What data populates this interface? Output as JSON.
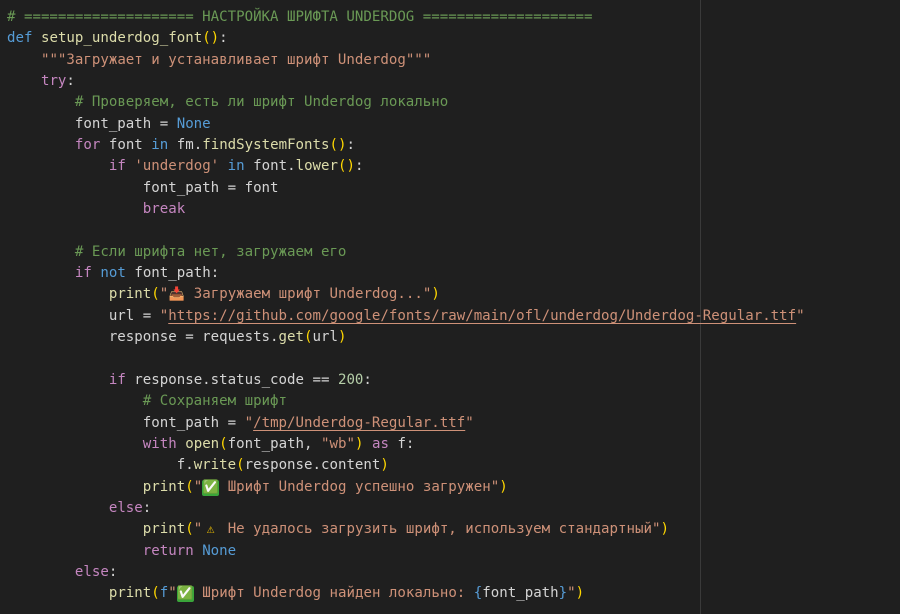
{
  "editor": {
    "language": "python",
    "lines": [
      [
        [
          "cm",
          "# ==================== НАСТРОЙКА ШРИФТА UNDERDOG ===================="
        ]
      ],
      [
        [
          "kw",
          "def"
        ],
        [
          "txt",
          " "
        ],
        [
          "fn",
          "setup_underdog_font"
        ],
        [
          "br1",
          "()"
        ],
        [
          "txt",
          ":"
        ]
      ],
      [
        [
          "txt",
          "    "
        ],
        [
          "str",
          "\"\"\"Загружает и устанавливает шрифт Underdog\"\"\""
        ]
      ],
      [
        [
          "txt",
          "    "
        ],
        [
          "ctl",
          "try"
        ],
        [
          "txt",
          ":"
        ]
      ],
      [
        [
          "txt",
          "        "
        ],
        [
          "cm",
          "# Проверяем, есть ли шрифт Underdog локально"
        ]
      ],
      [
        [
          "txt",
          "        font_path = "
        ],
        [
          "kw",
          "None"
        ]
      ],
      [
        [
          "txt",
          "        "
        ],
        [
          "ctl",
          "for"
        ],
        [
          "txt",
          " font "
        ],
        [
          "kw",
          "in"
        ],
        [
          "txt",
          " fm."
        ],
        [
          "fn",
          "findSystemFonts"
        ],
        [
          "br1",
          "()"
        ],
        [
          "txt",
          ":"
        ]
      ],
      [
        [
          "txt",
          "            "
        ],
        [
          "ctl",
          "if"
        ],
        [
          "txt",
          " "
        ],
        [
          "str",
          "'underdog'"
        ],
        [
          "txt",
          " "
        ],
        [
          "kw",
          "in"
        ],
        [
          "txt",
          " font."
        ],
        [
          "fn",
          "lower"
        ],
        [
          "br1",
          "()"
        ],
        [
          "txt",
          ":"
        ]
      ],
      [
        [
          "txt",
          "                font_path = font"
        ]
      ],
      [
        [
          "txt",
          "                "
        ],
        [
          "ctl",
          "break"
        ]
      ],
      [],
      [
        [
          "txt",
          "        "
        ],
        [
          "cm",
          "# Если шрифта нет, загружаем его"
        ]
      ],
      [
        [
          "txt",
          "        "
        ],
        [
          "ctl",
          "if"
        ],
        [
          "txt",
          " "
        ],
        [
          "kw",
          "not"
        ],
        [
          "txt",
          " font_path:"
        ]
      ],
      [
        [
          "txt",
          "            "
        ],
        [
          "fn",
          "print"
        ],
        [
          "br1",
          "("
        ],
        [
          "str",
          "\""
        ],
        [
          "emoji",
          "📥"
        ],
        [
          "str",
          " Загружаем шрифт Underdog...\""
        ],
        [
          "br1",
          ")"
        ]
      ],
      [
        [
          "txt",
          "            url = "
        ],
        [
          "str",
          "\""
        ],
        [
          "lnk",
          "https://github.com/google/fonts/raw/main/ofl/underdog/Underdog-Regular.ttf"
        ],
        [
          "str",
          "\""
        ]
      ],
      [
        [
          "txt",
          "            response = requests."
        ],
        [
          "fn",
          "get"
        ],
        [
          "br1",
          "("
        ],
        [
          "txt",
          "url"
        ],
        [
          "br1",
          ")"
        ]
      ],
      [],
      [
        [
          "txt",
          "            "
        ],
        [
          "ctl",
          "if"
        ],
        [
          "txt",
          " response.status_code == "
        ],
        [
          "num",
          "200"
        ],
        [
          "txt",
          ":"
        ]
      ],
      [
        [
          "txt",
          "                "
        ],
        [
          "cm",
          "# Сохраняем шрифт"
        ]
      ],
      [
        [
          "txt",
          "                font_path = "
        ],
        [
          "str",
          "\""
        ],
        [
          "lnk",
          "/tmp/Underdog-Regular.ttf"
        ],
        [
          "str",
          "\""
        ]
      ],
      [
        [
          "txt",
          "                "
        ],
        [
          "ctl",
          "with"
        ],
        [
          "txt",
          " "
        ],
        [
          "fn",
          "open"
        ],
        [
          "br1",
          "("
        ],
        [
          "txt",
          "font_path, "
        ],
        [
          "str",
          "\"wb\""
        ],
        [
          "br1",
          ")"
        ],
        [
          "txt",
          " "
        ],
        [
          "ctl",
          "as"
        ],
        [
          "txt",
          " f:"
        ]
      ],
      [
        [
          "txt",
          "                    f."
        ],
        [
          "fn",
          "write"
        ],
        [
          "br1",
          "("
        ],
        [
          "txt",
          "response.content"
        ],
        [
          "br1",
          ")"
        ]
      ],
      [
        [
          "txt",
          "                "
        ],
        [
          "fn",
          "print"
        ],
        [
          "br1",
          "("
        ],
        [
          "str",
          "\""
        ],
        [
          "emoji",
          "✅"
        ],
        [
          "str",
          " Шрифт Underdog успешно загружен\""
        ],
        [
          "br1",
          ")"
        ]
      ],
      [
        [
          "txt",
          "            "
        ],
        [
          "ctl",
          "else"
        ],
        [
          "txt",
          ":"
        ]
      ],
      [
        [
          "txt",
          "                "
        ],
        [
          "fn",
          "print"
        ],
        [
          "br1",
          "("
        ],
        [
          "str",
          "\""
        ],
        [
          "emoji",
          "⚠"
        ],
        [
          "str",
          " Не удалось загрузить шрифт, используем стандартный\""
        ],
        [
          "br1",
          ")"
        ]
      ],
      [
        [
          "txt",
          "                "
        ],
        [
          "ctl",
          "return"
        ],
        [
          "txt",
          " "
        ],
        [
          "kw",
          "None"
        ]
      ],
      [
        [
          "txt",
          "        "
        ],
        [
          "ctl",
          "else"
        ],
        [
          "txt",
          ":"
        ]
      ],
      [
        [
          "txt",
          "            "
        ],
        [
          "fn",
          "print"
        ],
        [
          "br1",
          "("
        ],
        [
          "kw",
          "f"
        ],
        [
          "str",
          "\""
        ],
        [
          "emoji",
          "✅"
        ],
        [
          "str",
          " Шрифт Underdog найден локально: "
        ],
        [
          "kw",
          "{"
        ],
        [
          "txt",
          "font_path"
        ],
        [
          "kw",
          "}"
        ],
        [
          "str",
          "\""
        ],
        [
          "br1",
          ")"
        ]
      ]
    ]
  },
  "colors": {
    "background": "#1f1f1f",
    "keyword": "#569cd6",
    "control": "#c586c0",
    "comment": "#6a9955",
    "string": "#ce9178",
    "number": "#b5cea8",
    "function": "#dcdcaa",
    "bracket": "#ffd700"
  }
}
